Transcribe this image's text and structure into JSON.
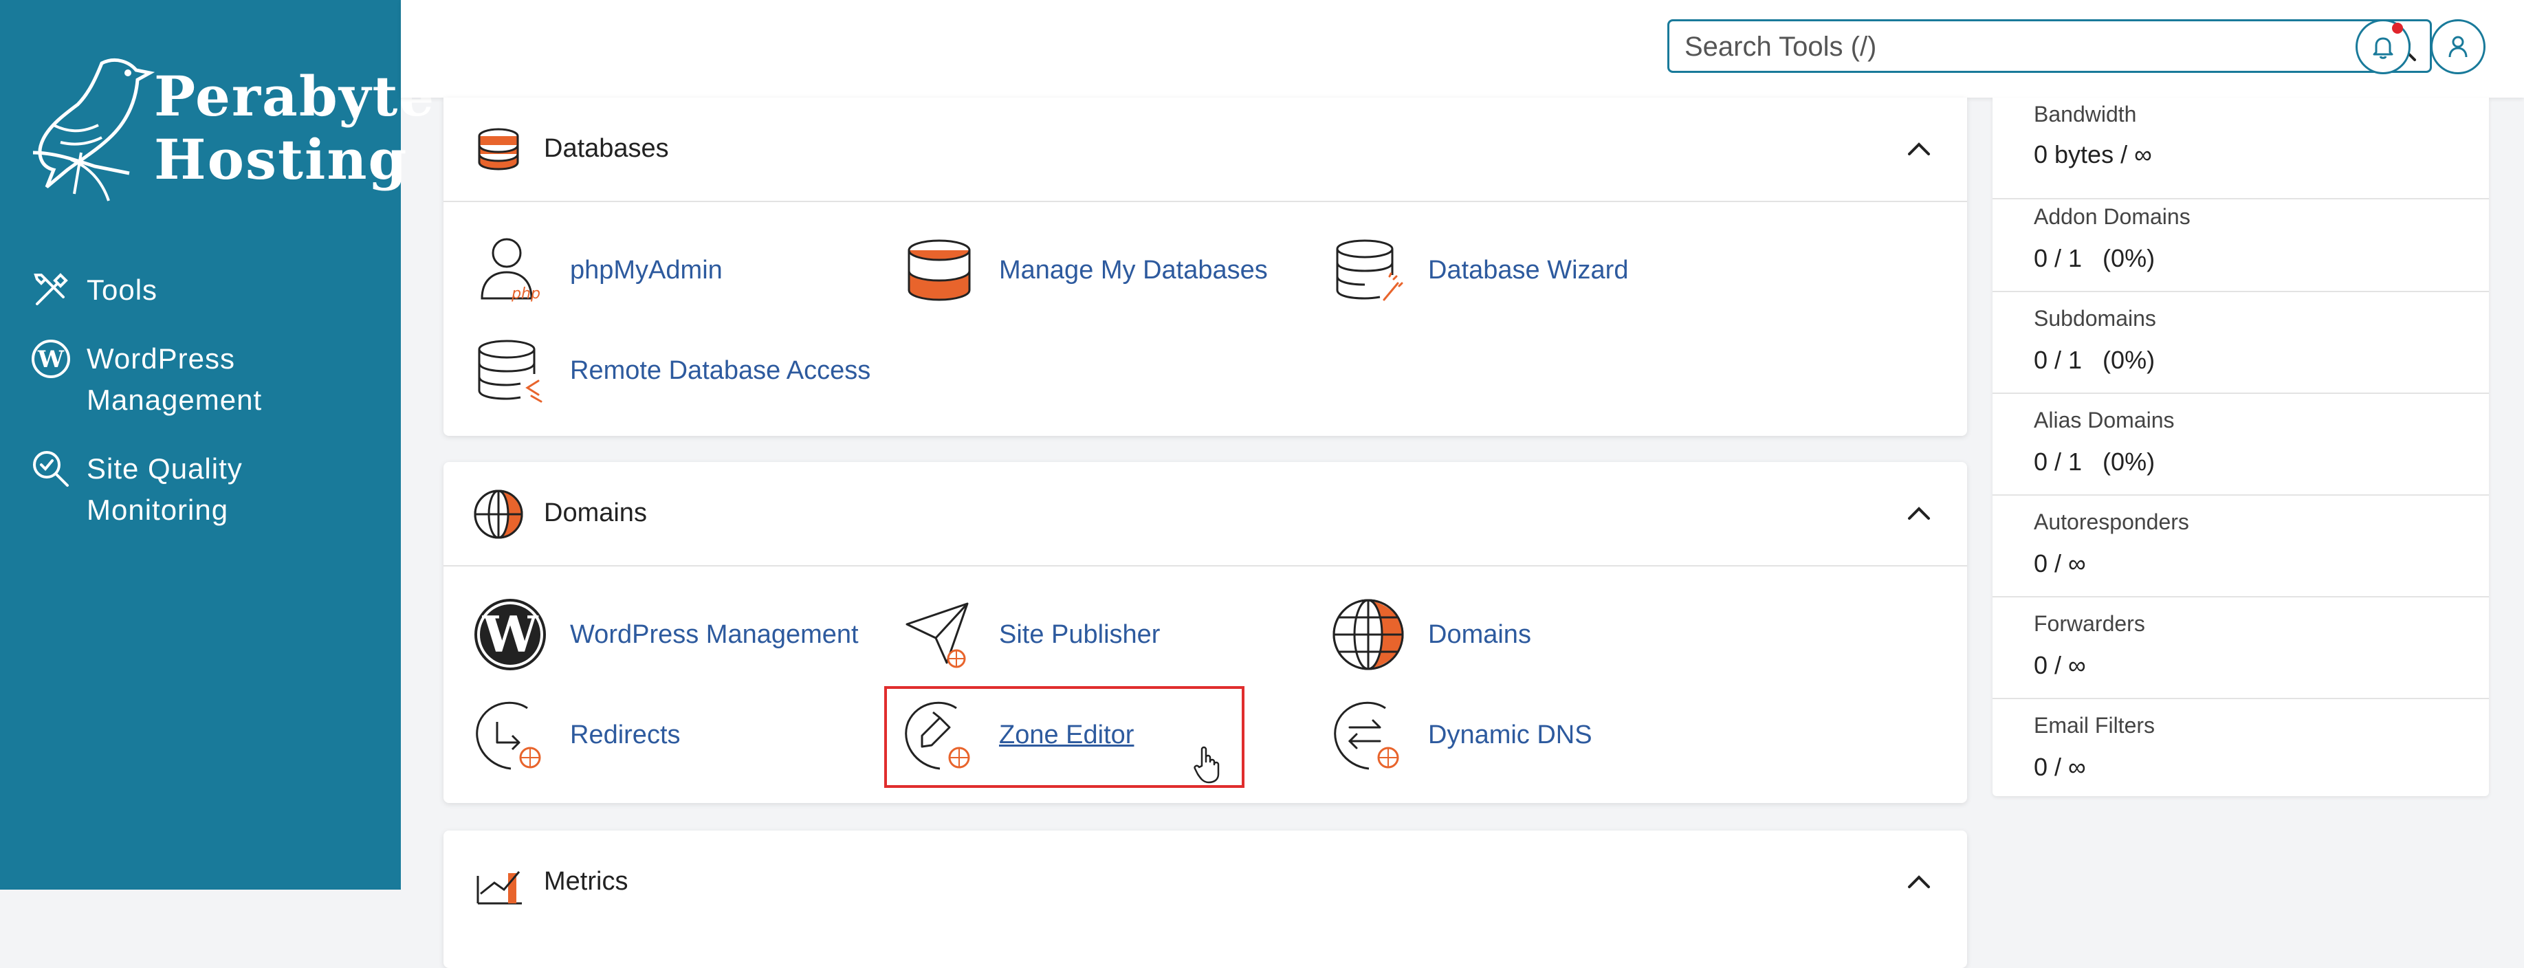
{
  "brand": {
    "line1": "Perabyte",
    "line2": "Hosting"
  },
  "sidebar": {
    "items": [
      {
        "icon": "tools-icon",
        "label_line1": "Tools",
        "label_line2": ""
      },
      {
        "icon": "wordpress-icon",
        "label_line1": "WordPress",
        "label_line2": "Management"
      },
      {
        "icon": "site-quality-icon",
        "label_line1": "Site Quality",
        "label_line2": "Monitoring"
      }
    ]
  },
  "header": {
    "search_placeholder": "Search Tools (/)"
  },
  "databases": {
    "title": "Databases",
    "tools": [
      {
        "label": "phpMyAdmin",
        "icon": "phpmyadmin-icon"
      },
      {
        "label": "Manage My Databases",
        "icon": "database-icon"
      },
      {
        "label": "Database Wizard",
        "icon": "database-wizard-icon"
      },
      {
        "label": "Remote Database Access",
        "icon": "remote-database-icon"
      }
    ]
  },
  "domains": {
    "title": "Domains",
    "tools": [
      {
        "label": "WordPress Management",
        "icon": "wordpress-icon"
      },
      {
        "label": "Site Publisher",
        "icon": "site-publisher-icon"
      },
      {
        "label": "Domains",
        "icon": "globe-icon"
      },
      {
        "label": "Redirects",
        "icon": "redirect-icon"
      },
      {
        "label": "Zone Editor",
        "icon": "zone-editor-icon"
      },
      {
        "label": "Dynamic DNS",
        "icon": "dynamic-dns-icon"
      }
    ]
  },
  "metrics": {
    "title": "Metrics"
  },
  "stats": [
    {
      "label": "Bandwidth",
      "value": "0 bytes / ∞"
    },
    {
      "label": "Addon Domains",
      "value": "0 / 1   (0%)"
    },
    {
      "label": "Subdomains",
      "value": "0 / 1   (0%)"
    },
    {
      "label": "Alias Domains",
      "value": "0 / 1   (0%)"
    },
    {
      "label": "Autoresponders",
      "value": "0 / ∞"
    },
    {
      "label": "Forwarders",
      "value": "0 / ∞"
    },
    {
      "label": "Email Filters",
      "value": "0 / ∞"
    }
  ],
  "colors": {
    "sidebar": "#197a9a",
    "accent": "#e8642c",
    "link": "#2d5a9e",
    "highlight": "#e02d2d"
  }
}
